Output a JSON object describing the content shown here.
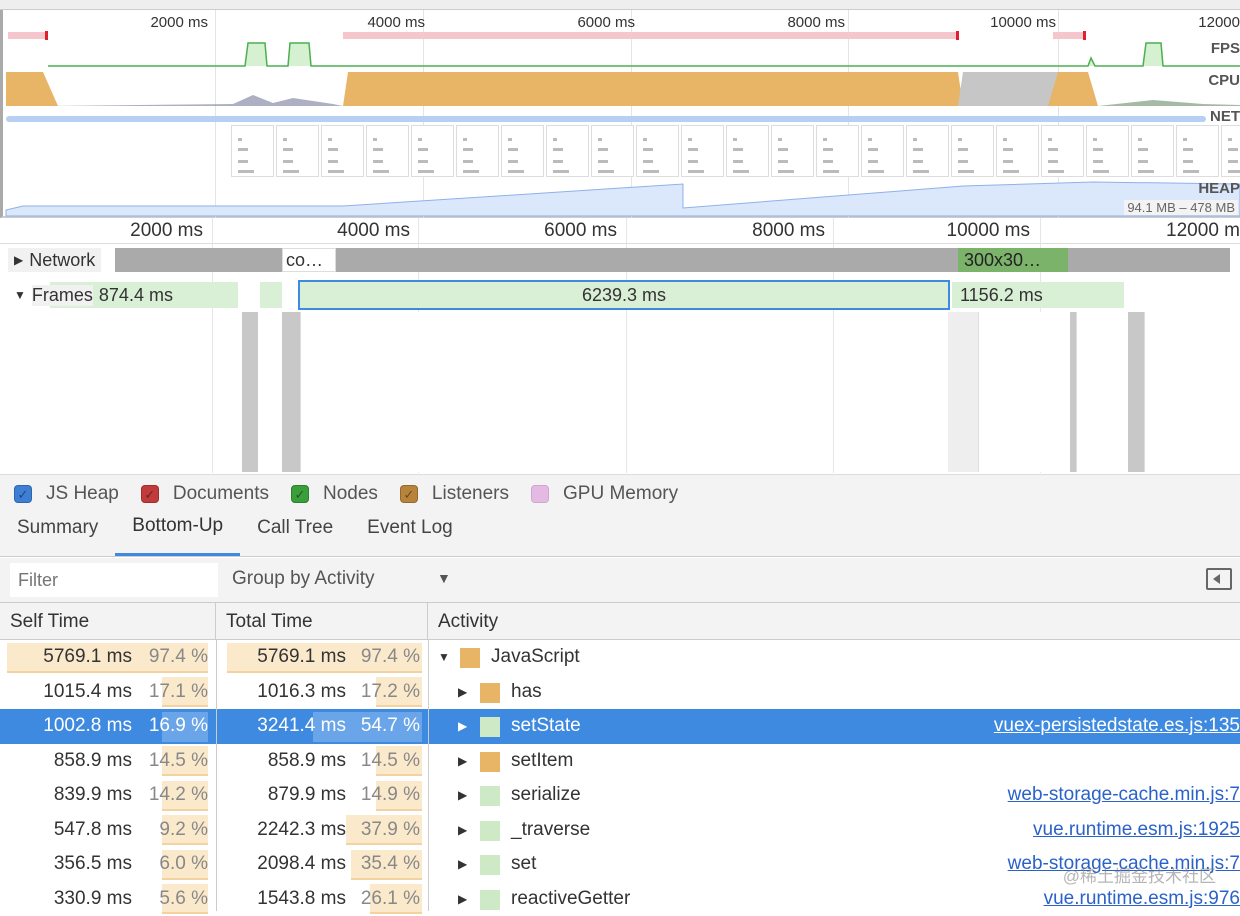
{
  "overview": {
    "ticks": [
      "2000 ms",
      "4000 ms",
      "6000 ms",
      "8000 ms",
      "10000 ms",
      "12000"
    ],
    "tracks": {
      "fps": "FPS",
      "cpu": "CPU",
      "net": "NET",
      "heap": "HEAP"
    },
    "heap_range": "94.1 MB – 478 MB"
  },
  "timeline": {
    "ticks": [
      "2000 ms",
      "4000 ms",
      "6000 ms",
      "8000 ms",
      "10000 ms",
      "12000 m"
    ],
    "network": {
      "label": "Network",
      "req1": "co…",
      "req2": "300x30…"
    },
    "frames": {
      "label": "Frames",
      "f1": "874.4 ms",
      "f2": "6239.3 ms",
      "f3": "1156.2 ms"
    }
  },
  "memory_legend": [
    {
      "label": "JS Heap",
      "color": "#3e7fd6",
      "checked": true
    },
    {
      "label": "Documents",
      "color": "#c23b3b",
      "checked": true
    },
    {
      "label": "Nodes",
      "color": "#3a9f3a",
      "checked": true
    },
    {
      "label": "Listeners",
      "color": "#b8843c",
      "checked": true
    },
    {
      "label": "GPU Memory",
      "color": "#d98ad9",
      "checked": false
    }
  ],
  "tabs": [
    "Summary",
    "Bottom-Up",
    "Call Tree",
    "Event Log"
  ],
  "active_tab": "Bottom-Up",
  "filter": {
    "placeholder": "Filter",
    "group_by": "Group by Activity"
  },
  "table": {
    "headers": {
      "self": "Self Time",
      "total": "Total Time",
      "activity": "Activity"
    },
    "rows": [
      {
        "self_ms": "5769.1 ms",
        "self_pct": "97.4 %",
        "self_p": 97.4,
        "total_ms": "5769.1 ms",
        "total_pct": "97.4 %",
        "total_p": 97.4,
        "name": "JavaScript",
        "color": "#e8b566",
        "expanded": true,
        "depth": 0,
        "url": ""
      },
      {
        "self_ms": "1015.4 ms",
        "self_pct": "17.1 %",
        "self_p": 17.1,
        "total_ms": "1016.3 ms",
        "total_pct": "17.2 %",
        "total_p": 17.2,
        "name": "has",
        "color": "#e8b566",
        "depth": 1,
        "url": ""
      },
      {
        "self_ms": "1002.8 ms",
        "self_pct": "16.9 %",
        "self_p": 16.9,
        "total_ms": "3241.4 ms",
        "total_pct": "54.7 %",
        "total_p": 54.7,
        "name": "setState",
        "color": "#cde9c6",
        "depth": 1,
        "url": "vuex-persistedstate.es.js:135",
        "selected": true
      },
      {
        "self_ms": "858.9 ms",
        "self_pct": "14.5 %",
        "self_p": 14.5,
        "total_ms": "858.9 ms",
        "total_pct": "14.5 %",
        "total_p": 14.5,
        "name": "setItem",
        "color": "#e8b566",
        "depth": 1,
        "url": ""
      },
      {
        "self_ms": "839.9 ms",
        "self_pct": "14.2 %",
        "self_p": 14.2,
        "total_ms": "879.9 ms",
        "total_pct": "14.9 %",
        "total_p": 14.9,
        "name": "serialize",
        "color": "#cde9c6",
        "depth": 1,
        "url": "web-storage-cache.min.js:7"
      },
      {
        "self_ms": "547.8 ms",
        "self_pct": "9.2 %",
        "self_p": 9.2,
        "total_ms": "2242.3 ms",
        "total_pct": "37.9 %",
        "total_p": 37.9,
        "name": "_traverse",
        "color": "#cde9c6",
        "depth": 1,
        "url": "vue.runtime.esm.js:1925"
      },
      {
        "self_ms": "356.5 ms",
        "self_pct": "6.0 %",
        "self_p": 6.0,
        "total_ms": "2098.4 ms",
        "total_pct": "35.4 %",
        "total_p": 35.4,
        "name": "set",
        "color": "#cde9c6",
        "depth": 1,
        "url": "web-storage-cache.min.js:7"
      },
      {
        "self_ms": "330.9 ms",
        "self_pct": "5.6 %",
        "self_p": 5.6,
        "total_ms": "1543.8 ms",
        "total_pct": "26.1 %",
        "total_p": 26.1,
        "name": "reactiveGetter",
        "color": "#cde9c6",
        "depth": 1,
        "url": "vue.runtime.esm.js:976"
      }
    ]
  },
  "watermark": "@稀土掘金技术社区"
}
